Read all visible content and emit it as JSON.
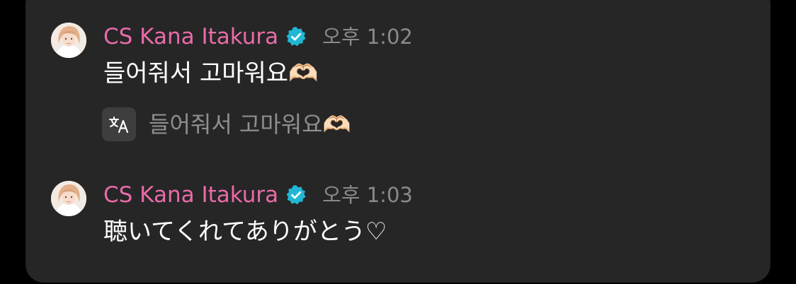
{
  "messages": [
    {
      "author": "CS Kana Itakura",
      "time": "오후 1:02",
      "text": "들어줘서 고마워요🫶🏻",
      "translation": "들어줘서 고마워요🫶🏻"
    },
    {
      "author": "CS Kana Itakura",
      "time": "오후 1:03",
      "text": "聴いてくれてありがとう♡"
    }
  ],
  "icons": {
    "verified": "verified-badge-icon",
    "translate": "translate-icon"
  },
  "colors": {
    "background": "#262626",
    "author": "#e96ba9",
    "verified": "#1fb7d4",
    "time": "#8a8a8a",
    "text": "#ffffff"
  }
}
